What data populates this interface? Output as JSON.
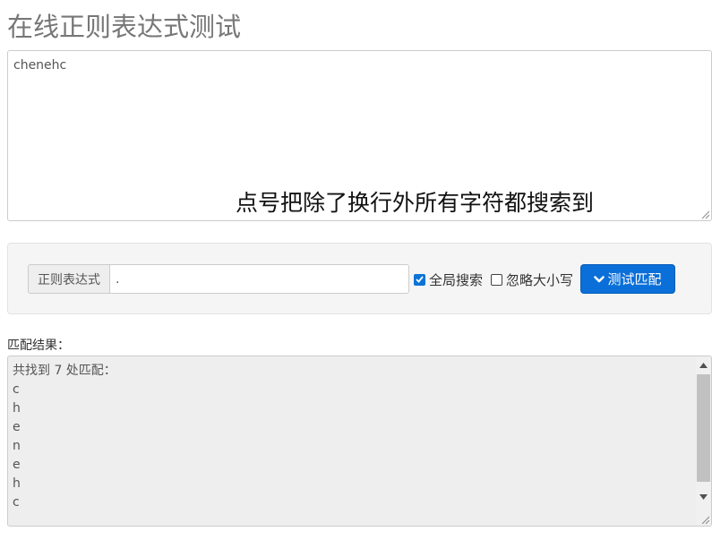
{
  "page": {
    "title": "在线正则表达式测试"
  },
  "source": {
    "text": "chenehc"
  },
  "overlay": {
    "caption": "点号把除了换行外所有字符都搜索到"
  },
  "toolbar": {
    "regex_label": "正则表达式",
    "regex_value": ".",
    "global_label": "全局搜索",
    "global_checked": true,
    "ignore_case_label": "忽略大小写",
    "ignore_case_checked": false,
    "test_button_label": "测试匹配",
    "test_button_icon": "chevron-down-icon"
  },
  "result": {
    "label": "匹配结果：",
    "lines": [
      "共找到 7 处匹配：",
      "c",
      "h",
      "e",
      "n",
      "e",
      "h",
      "c"
    ]
  },
  "colors": {
    "primary": "#0a6fd8",
    "panel": "#f5f5f5",
    "result_bg": "#eeeeee"
  }
}
